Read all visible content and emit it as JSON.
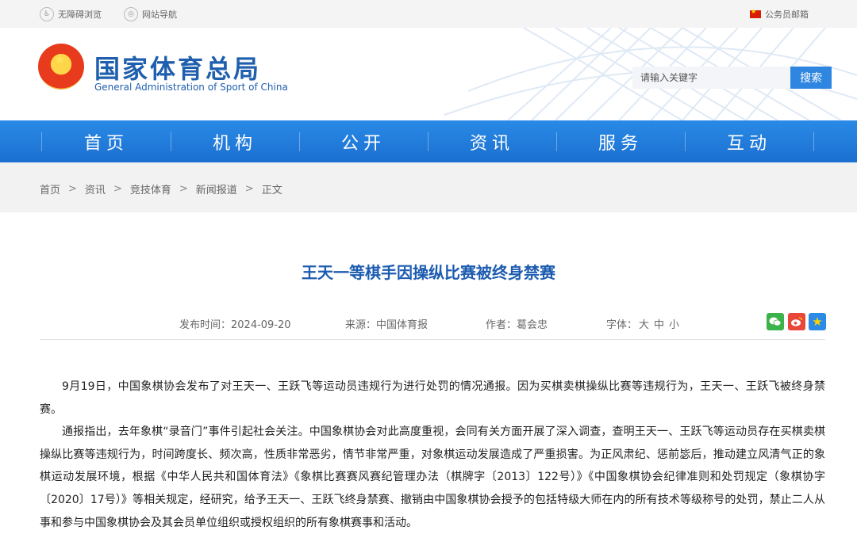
{
  "topbar": {
    "accessibility": "无障碍浏览",
    "site_nav": "网站导航",
    "mail": "公务员邮箱"
  },
  "header": {
    "logo_cn": "国家体育总局",
    "logo_en": "General Administration of Sport of China",
    "search_placeholder": "请输入关键字",
    "search_button": "搜索"
  },
  "nav": {
    "items": [
      "首页",
      "机构",
      "公开",
      "资讯",
      "服务",
      "互动"
    ]
  },
  "breadcrumb": [
    "首页",
    "资讯",
    "竞技体育",
    "新闻报道",
    "正文"
  ],
  "article": {
    "title": "王天一等棋手因操纵比赛被终身禁赛",
    "publish_time": "发布时间：2024-09-20",
    "source": "来源：中国体育报",
    "author": "作者：葛会忠",
    "font_label": "字体：",
    "font_sizes": [
      "大",
      "中",
      "小"
    ],
    "share_icons": [
      "wechat-icon",
      "weibo-icon",
      "qzone-icon"
    ],
    "paragraphs": [
      "9月19日，中国象棋协会发布了对王天一、王跃飞等运动员违规行为进行处罚的情况通报。因为买棋卖棋操纵比赛等违规行为，王天一、王跃飞被终身禁赛。",
      "通报指出，去年象棋“录音门”事件引起社会关注。中国象棋协会对此高度重视，会同有关方面开展了深入调查，查明王天一、王跃飞等运动员存在买棋卖棋操纵比赛等违规行为，时间跨度长、频次高，性质非常恶劣，情节非常严重，对象棋运动发展造成了严重损害。为正风肃纪、惩前毖后，推动建立风清气正的象棋运动发展环境，根据《中华人民共和国体育法》《象棋比赛赛风赛纪管理办法（棋牌字〔2013〕122号）》《中国象棋协会纪律准则和处罚规定（象棋协字〔2020〕17号）》等相关规定，经研究，给予王天一、王跃飞终身禁赛、撤销由中国象棋协会授予的包括特级大师在内的所有技术等级称号的处罚，禁止二人从事和参与中国象棋协会及其会员单位组织或授权组织的所有象棋赛事和活动。"
    ]
  },
  "colors": {
    "brand_blue": "#1f5fae",
    "nav_blue": "#1b6fd0",
    "title_blue": "#1d5cb0"
  }
}
